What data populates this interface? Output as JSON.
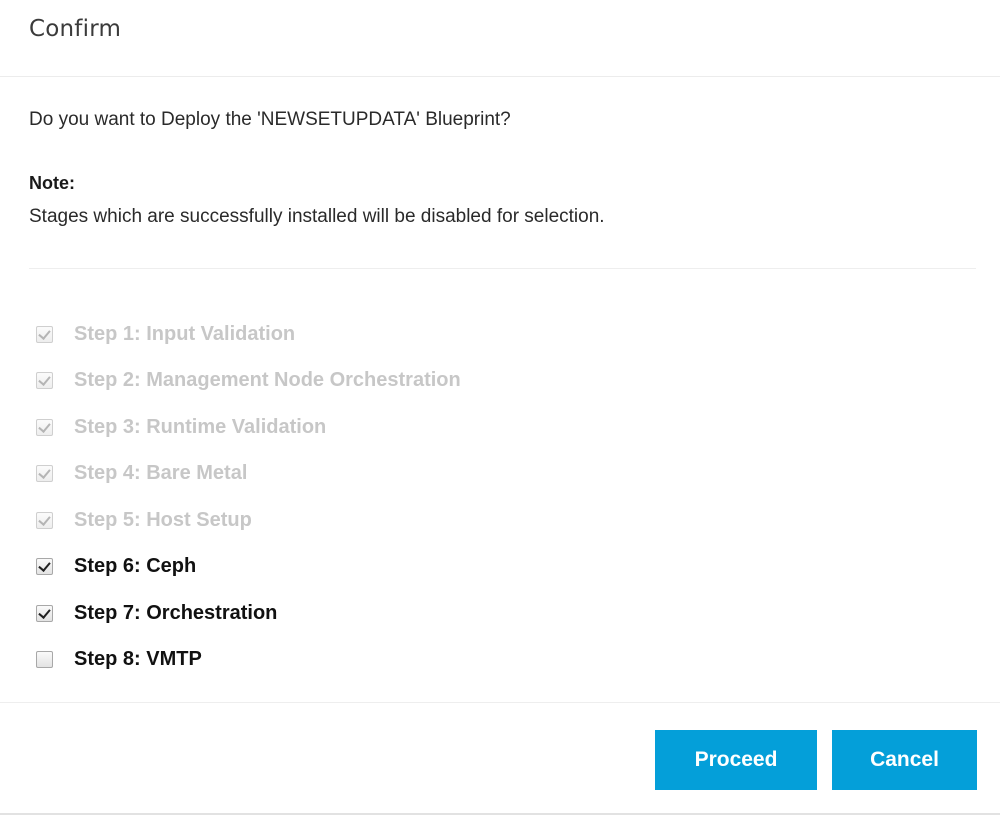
{
  "dialog": {
    "title": "Confirm",
    "question": "Do you want to Deploy the 'NEWSETUPDATA' Blueprint?",
    "note_label": "Note:",
    "note_text": "Stages which are successfully installed will be disabled for selection."
  },
  "steps": [
    {
      "label": "Step 1: Input Validation",
      "checked": true,
      "disabled": true
    },
    {
      "label": "Step 2: Management Node Orchestration",
      "checked": true,
      "disabled": true
    },
    {
      "label": "Step 3: Runtime Validation",
      "checked": true,
      "disabled": true
    },
    {
      "label": "Step 4: Bare Metal",
      "checked": true,
      "disabled": true
    },
    {
      "label": "Step 5: Host Setup",
      "checked": true,
      "disabled": true
    },
    {
      "label": "Step 6: Ceph",
      "checked": true,
      "disabled": false
    },
    {
      "label": "Step 7: Orchestration",
      "checked": true,
      "disabled": false
    },
    {
      "label": "Step 8: VMTP",
      "checked": false,
      "disabled": false
    }
  ],
  "footer": {
    "proceed_label": "Proceed",
    "cancel_label": "Cancel"
  },
  "colors": {
    "primary_button": "#049fd9",
    "disabled_text": "#c7c7c7"
  }
}
